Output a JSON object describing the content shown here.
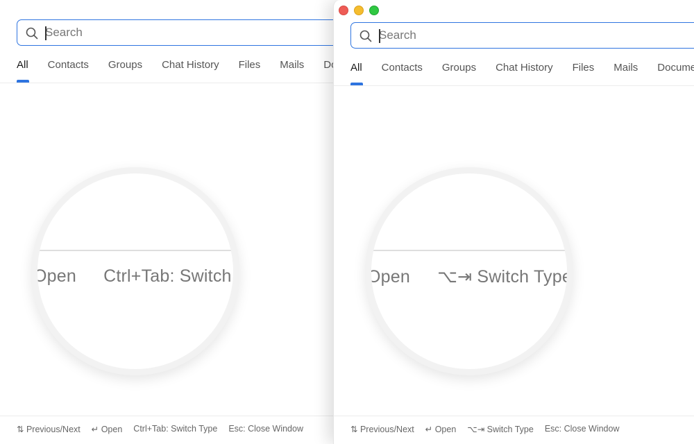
{
  "search": {
    "placeholder": "Search"
  },
  "tabs": [
    "All",
    "Contacts",
    "Groups",
    "Chat History",
    "Files",
    "Mails",
    "Documents"
  ],
  "left": {
    "magnifier": {
      "open": "Open",
      "switch": "Ctrl+Tab: Switch Type"
    },
    "footer": [
      "⇅ Previous/Next",
      "↵ Open",
      "Ctrl+Tab: Switch Type",
      "Esc: Close Window"
    ]
  },
  "right": {
    "magnifier": {
      "open": "Open",
      "switch": "⌥⇥ Switch Type"
    },
    "footer": [
      "⇅ Previous/Next",
      "↵ Open",
      "⌥⇥ Switch Type",
      "Esc: Close Window"
    ]
  },
  "colors": {
    "accent": "#2e74e0"
  },
  "icons": {
    "search": "search-icon"
  }
}
